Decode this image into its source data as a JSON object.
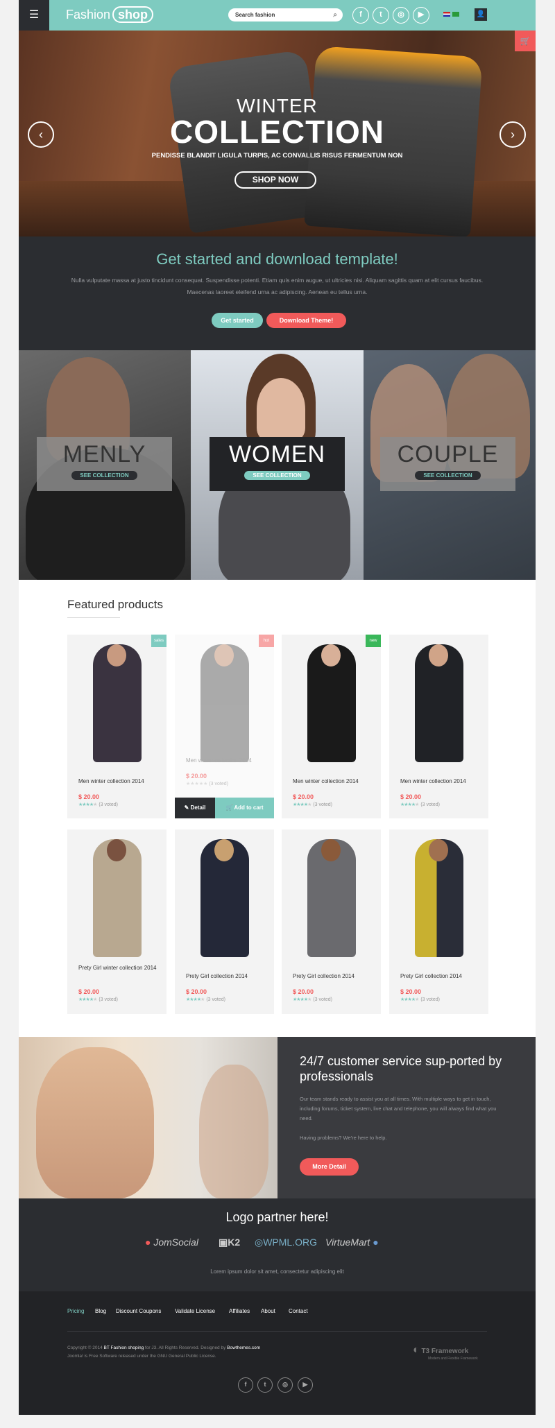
{
  "header": {
    "menu_icon": "☰",
    "logo_text": "Fashion",
    "logo_badge": "shop",
    "search_placeholder": "Search fashion",
    "social": [
      {
        "name": "facebook",
        "glyph": "f"
      },
      {
        "name": "twitter",
        "glyph": "t"
      },
      {
        "name": "instagram",
        "glyph": "◎"
      },
      {
        "name": "youtube",
        "glyph": "▶"
      }
    ],
    "user_icon": "👤",
    "cart_icon": "🛒"
  },
  "hero": {
    "line1": "WINTER",
    "line2": "COLLECTION",
    "line3": "PENDISSE BLANDIT LIGULA TURPIS, AC CONVALLIS RISUS FERMENTUM NON",
    "cta": "SHOP NOW",
    "prev": "‹",
    "next": "›"
  },
  "get_started": {
    "title": "Get started and download template!",
    "text": "Nulla vulputate massa at justo tincidunt consequat. Suspendisse potenti. Etiam quis enim augue, ut ultricies nisi. Aliquam sagittis quam at elit cursus faucibus. Maecenas laoreet eleifend urna ac adipiscing. Aenean eu tellus urna.",
    "btn_start": "Get started",
    "btn_download": "Download Theme!"
  },
  "collections": [
    {
      "name": "MENLY",
      "see": "SEE COLLECTION"
    },
    {
      "name": "WOMEN",
      "see": "SEE COLLECTION"
    },
    {
      "name": "COUPLE",
      "see": "SEE COLLECTION"
    }
  ],
  "featured": {
    "title": "Featured products",
    "detail_label": "Detail",
    "add_cart_label": "Add to cart",
    "products": [
      {
        "name": "Men winter collection 2014",
        "price": "$ 20.00",
        "votes": "(3 voted)",
        "badge": "sales"
      },
      {
        "name": "Men winter collection 2014",
        "price": "$ 20.00",
        "votes": "(3 voted)",
        "badge": "hot"
      },
      {
        "name": "Men winter collection 2014",
        "price": "$ 20.00",
        "votes": "(3 voted)",
        "badge": "new"
      },
      {
        "name": "Men winter collection 2014",
        "price": "$ 20.00",
        "votes": "(3 voted)",
        "badge": ""
      },
      {
        "name": "Prety Girl winter collection 2014",
        "price": "$ 20.00",
        "votes": "(3 voted)",
        "badge": ""
      },
      {
        "name": "Prety Girl collection 2014",
        "price": "$ 20.00",
        "votes": "(3 voted)",
        "badge": ""
      },
      {
        "name": "Prety Girl collection 2014",
        "price": "$ 20.00",
        "votes": "(3 voted)",
        "badge": ""
      },
      {
        "name": "Prety Girl collection 2014",
        "price": "$ 20.00",
        "votes": "(3 voted)",
        "badge": ""
      }
    ]
  },
  "service": {
    "title": "24/7 customer service sup-ported by professionals",
    "text": "Our team stands ready to assist you at all times. With multiple ways to get in touch, including forums, ticket system, live chat and telephone, you will always find what you need.",
    "text2": "Having problems? We're here to help.",
    "button": "More Detail"
  },
  "partners": {
    "title": "Logo partner here!",
    "logos": [
      "JomSocial",
      "K2",
      "WPML.ORG",
      "VirtueMart"
    ],
    "text": "Lorem ipsum dolor sit amet, consectetur adipiscing elit"
  },
  "footer": {
    "nav": [
      "Pricing",
      "Blog",
      "Discount Coupons",
      "Validate License",
      "Affiliates",
      "About",
      "Contact"
    ],
    "copy_pre": "Copyright © 2014",
    "copy_brand": "BT Fashion shoping",
    "copy_mid": " for J3. All Rights Reserved. Designed by ",
    "copy_designer": "Bowthemes.com",
    "copy_line2": "Joomla! is Free Software released under the GNU General Public License.",
    "t3_name": "T3 Framework",
    "t3_sub": "Modern and Flexible Framework",
    "social": [
      "f",
      "t",
      "◎",
      "▶"
    ]
  },
  "colors": {
    "accent": "#7ecbc0",
    "danger": "#f15a5a",
    "dark": "#2b2d31"
  }
}
